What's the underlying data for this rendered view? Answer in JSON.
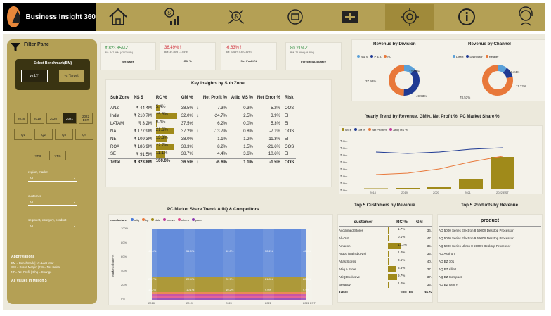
{
  "app": {
    "title": "Business Insight 360"
  },
  "nav": [
    "home-icon",
    "finance-icon",
    "sales-icon",
    "marketing-icon",
    "supply-chain-icon",
    "executive-icon",
    "info-icon",
    "support-icon"
  ],
  "filter": {
    "title": "Filter Pane",
    "benchmark_label": "Select Benchmark(BM)",
    "bm_options": [
      "vs LY",
      "vs Target"
    ],
    "years": [
      "2018",
      "2019",
      "2020",
      "2021",
      "2022 EST"
    ],
    "quarters": [
      "Q1",
      "Q2",
      "Q3",
      "Q4"
    ],
    "ytd": [
      "YTD",
      "YTG"
    ],
    "slicers": [
      {
        "label": "region, market",
        "value": "All"
      },
      {
        "label": "customer",
        "value": "All"
      },
      {
        "label": "segment, category, product",
        "value": "All"
      }
    ],
    "abbr_title": "Abbreviations",
    "abbr": [
      "BM = Benchmark | LY=Last Year",
      "GM = Gross Margin | NS = Net Sales",
      "NP= Net Profit | Chg = Change"
    ],
    "values_note": "All values in Million $"
  },
  "kpis": [
    {
      "value": "₹ 823.85M✓",
      "sub": "BM: 247.96M (+207.43%)",
      "label": "Net Sales"
    },
    {
      "value": "36.49% !",
      "sub": "BM: 37.16% (-1.65%)",
      "label": "GM %"
    },
    {
      "value": "-6.63% !",
      "sub": "BM: -0.65% (-470.36%)",
      "label": "Net Profit %"
    },
    {
      "value": "80.21%✓",
      "sub": "BM: 72.99% (+9.88%)",
      "label": "Forecast Accuracy"
    }
  ],
  "key_insights": {
    "title": "Key Insights by Sub Zone",
    "headers": [
      "Sub Zone",
      "NS $",
      "RC %",
      "GM %",
      "Net Profit %",
      "Atliq MS %",
      "Net Error %",
      "Risk"
    ],
    "rows": [
      {
        "zone": "ANZ",
        "ns": "₹ 44.4M",
        "rc": "5.4%",
        "rcv": 5.4,
        "gm": "38.5%",
        "gmArrow": "↓",
        "np": "7.3%",
        "ms": "0.3%",
        "ne": "-5.2%",
        "risk": "OOS"
      },
      {
        "zone": "India",
        "ns": "₹ 210.7M",
        "rc": "25.6%",
        "rcv": 25.6,
        "gm": "32.0%",
        "gmArrow": "↓",
        "np": "-24.7%",
        "ms": "2.5%",
        "ne": "3.9%",
        "risk": "EI"
      },
      {
        "zone": "LATAM",
        "ns": "₹ 3.2M",
        "rc": "0.4%",
        "rcv": 0.4,
        "gm": "37.5%",
        "gmArrow": "",
        "np": "6.2%",
        "ms": "0.0%",
        "ne": "5.3%",
        "risk": "EI"
      },
      {
        "zone": "NA",
        "ns": "₹ 177.9M",
        "rc": "21.6%",
        "rcv": 21.6,
        "gm": "37.2%",
        "gmArrow": "↓",
        "np": "-13.7%",
        "ms": "0.8%",
        "ne": "-7.1%",
        "risk": "OOS"
      },
      {
        "zone": "NE",
        "ns": "₹ 109.3M",
        "rc": "13.3%",
        "rcv": 13.3,
        "gm": "38.0%",
        "gmArrow": "",
        "np": "1.1%",
        "ms": "1.2%",
        "ne": "11.3%",
        "risk": "EI"
      },
      {
        "zone": "ROA",
        "ns": "₹ 186.9M",
        "rc": "22.7%",
        "rcv": 22.7,
        "gm": "38.3%",
        "gmArrow": "",
        "np": "8.2%",
        "ms": "1.5%",
        "ne": "-21.6%",
        "risk": "OOS"
      },
      {
        "zone": "SE",
        "ns": "₹ 91.5M",
        "rc": "11.1%",
        "rcv": 11.1,
        "gm": "38.7%",
        "gmArrow": "",
        "np": "4.4%",
        "ms": "3.6%",
        "ne": "10.6%",
        "risk": "EI"
      }
    ],
    "total": {
      "zone": "Total",
      "ns": "₹ 823.8M",
      "rc": "100.0%",
      "gm": "36.5%",
      "gmArrow": "↓",
      "np": "-6.6%",
      "ms": "1.1%",
      "ne": "-1.5%",
      "risk": "OOS"
    }
  },
  "rev_division": {
    "title": "Revenue by Division",
    "legend": [
      "N & S",
      "P & A",
      "PC"
    ],
    "colors": [
      "#5aa0d8",
      "#1f3a93",
      "#e8783a"
    ],
    "labels": [
      "12.69%",
      "37.98%",
      "49.93%"
    ]
  },
  "rev_channel": {
    "title": "Revenue by Channel",
    "legend": [
      "Direct",
      "Distributor",
      "Retailer"
    ],
    "colors": [
      "#5aa0d8",
      "#1f3a93",
      "#e8783a"
    ],
    "labels": [
      "10.24%",
      "11.22%",
      "78.53%"
    ]
  },
  "trend": {
    "title": "Yearly Trend by Revenue, GM%, Net Profit %, PC Market Share %",
    "legend": [
      "NS $",
      "GM %",
      "Net Profit %",
      "AtliQ MS %"
    ],
    "legend_colors": [
      "#a08a1a",
      "#1f3a93",
      "#e8783a",
      "#c03a9a"
    ],
    "yticks": [
      "₹ 8bn",
      "₹ 8bn",
      "₹ 8bn",
      "₹ 8bn",
      "₹ 8bn",
      "₹ 8bn",
      "₹ 8bn",
      "₹ 8bn"
    ],
    "years": [
      "2018",
      "2019",
      "2020",
      "2021",
      "2022 EST"
    ]
  },
  "market_share": {
    "title": "PC Market Share Trend-  AtliQ & Competitors",
    "legend_title": "manufacturer",
    "manufacturers": [
      "atliq",
      "bp",
      "dale",
      "innovo",
      "others",
      "pacer"
    ],
    "colors": [
      "#4a7ad8",
      "#e8783a",
      "#a08a1a",
      "#c03a9a",
      "#e04a8a",
      "#8a3ab0"
    ],
    "ylabel": "Market Share %",
    "years": [
      "2018",
      "2019",
      "2020",
      "2021",
      "2022 EST"
    ],
    "yticks": [
      "100%",
      "80%",
      "60%",
      "40%",
      "20%",
      "0%"
    ],
    "labels_top": [
      "46.6%",
      "51.5%",
      "52.0%",
      "52.2%",
      "46.4%"
    ],
    "labels_mid": [
      "20.7%",
      "22.4%",
      "22.7%",
      "21.8%",
      "22.3%"
    ],
    "labels_low": [
      "11.2%",
      "10.1%",
      "10.2%",
      "9.6%",
      "9.9%"
    ]
  },
  "top_customers": {
    "title": "Top 5 Customers by Revenue",
    "headers": [
      "customer",
      "RC %",
      "GM"
    ],
    "rows": [
      {
        "name": "Acclaimed Stores",
        "rc": "1.7%",
        "v": 1.7,
        "gm": "36."
      },
      {
        "name": "All-Out",
        "rc": "0.1%",
        "v": 0.1,
        "gm": "47."
      },
      {
        "name": "Amazon",
        "rc": "13.2%",
        "v": 13.2,
        "gm": "35."
      },
      {
        "name": "Argos (Sainsbury's)",
        "rc": "1.0%",
        "v": 1.0,
        "gm": "35."
      },
      {
        "name": "Atlas Stores",
        "rc": "0.5%",
        "v": 0.5,
        "gm": "40."
      },
      {
        "name": "Atliq e Store",
        "rc": "8.5%",
        "v": 8.5,
        "gm": "37."
      },
      {
        "name": "AtliQ Exclusive",
        "rc": "9.7%",
        "v": 9.7,
        "gm": "37."
      },
      {
        "name": "BestBuy",
        "rc": "1.0%",
        "v": 1.0,
        "gm": "35."
      }
    ],
    "total": {
      "name": "Total",
      "rc": "100.0%",
      "gm": "36.5"
    }
  },
  "top_products": {
    "title": "Top 5 Products by Revenue",
    "header": "product",
    "rows": [
      "AQ 5000 Series Electron 8 5900X Desktop Processor",
      "AQ 5000 Series Electron 9 5900X Desktop Processor",
      "AQ 5000 Series Ultron 8 5900X Desktop Processor",
      "AQ Aspiron",
      "AQ BZ 101",
      "AQ BZ Allin1",
      "AQ BZ Compact",
      "AQ BZ Gen Y"
    ]
  }
}
